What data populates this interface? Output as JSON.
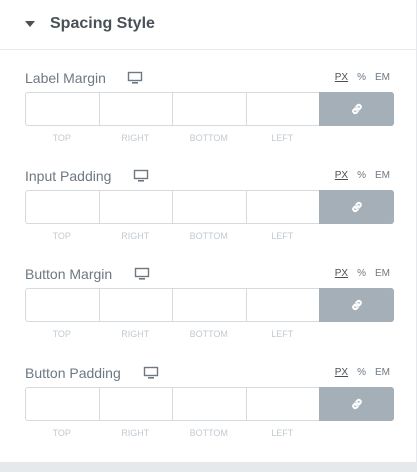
{
  "section": {
    "title": "Spacing Style",
    "expanded": true
  },
  "units": {
    "px": "PX",
    "percent": "%",
    "em": "EM",
    "selected": "PX"
  },
  "dimension_labels": {
    "top": "TOP",
    "right": "RIGHT",
    "bottom": "BOTTOM",
    "left": "LEFT"
  },
  "controls": [
    {
      "label": "Label Margin",
      "values": {
        "top": "",
        "right": "",
        "bottom": "",
        "left": ""
      },
      "linked": true
    },
    {
      "label": "Input Padding",
      "values": {
        "top": "",
        "right": "",
        "bottom": "",
        "left": ""
      },
      "linked": true
    },
    {
      "label": "Button Margin",
      "values": {
        "top": "",
        "right": "",
        "bottom": "",
        "left": ""
      },
      "linked": true
    },
    {
      "label": "Button Padding",
      "values": {
        "top": "",
        "right": "",
        "bottom": "",
        "left": ""
      },
      "linked": true
    }
  ],
  "colors": {
    "link_button": "#a4afb7",
    "text": "#6d7882",
    "heading": "#495157",
    "border": "#d5dadf"
  },
  "icons": {
    "device": "desktop-icon",
    "link": "link-icon",
    "caret": "caret-down-icon"
  }
}
